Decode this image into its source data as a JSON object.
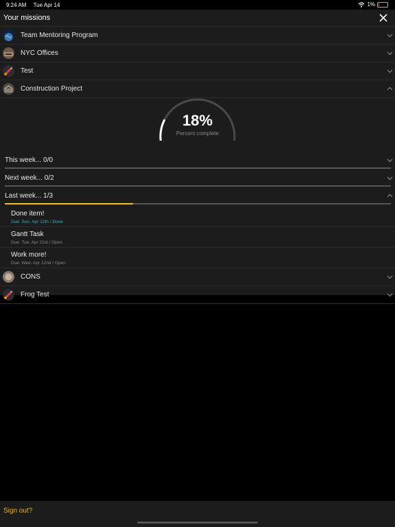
{
  "status_bar": {
    "time": "9:24 AM",
    "date": "Tue Apr 14",
    "battery": "1%"
  },
  "header": {
    "title": "Your missions"
  },
  "missions_top": [
    {
      "label": "Team Mentoring Program",
      "icon": "globe-avatar"
    },
    {
      "label": "NYC Offices",
      "icon": "office-avatar"
    },
    {
      "label": "Test",
      "icon": "rocket-avatar"
    },
    {
      "label": "Construction Project",
      "icon": "construction-avatar"
    }
  ],
  "progress": {
    "value_text": "18%",
    "fraction": 0.18,
    "caption": "Percent complete"
  },
  "weeks": [
    {
      "label": "This week... 0/0",
      "fraction": 0
    },
    {
      "label": "Next week... 0/2",
      "fraction": 0
    },
    {
      "label": "Last week... 1/3",
      "fraction": 0.333
    }
  ],
  "tasks": [
    {
      "name": "Done item!",
      "due": "Due: Sun. Apr 12th / Done",
      "done": true
    },
    {
      "name": "Gantt Task",
      "due": "Due: Tue. Apr 21st / Open",
      "done": false
    },
    {
      "name": "Work more!",
      "due": "Due: Wed. Apr 22nd / Open",
      "done": false
    }
  ],
  "missions_bottom": [
    {
      "label": "CONS",
      "icon": "cons-avatar"
    },
    {
      "label": "Frog Test",
      "icon": "rocket-avatar"
    }
  ],
  "footer": {
    "sign_out": "Sign out?"
  },
  "colors": {
    "accent": "#f6c400",
    "done": "#2ab3d6",
    "panel": "#1c1c1c"
  }
}
